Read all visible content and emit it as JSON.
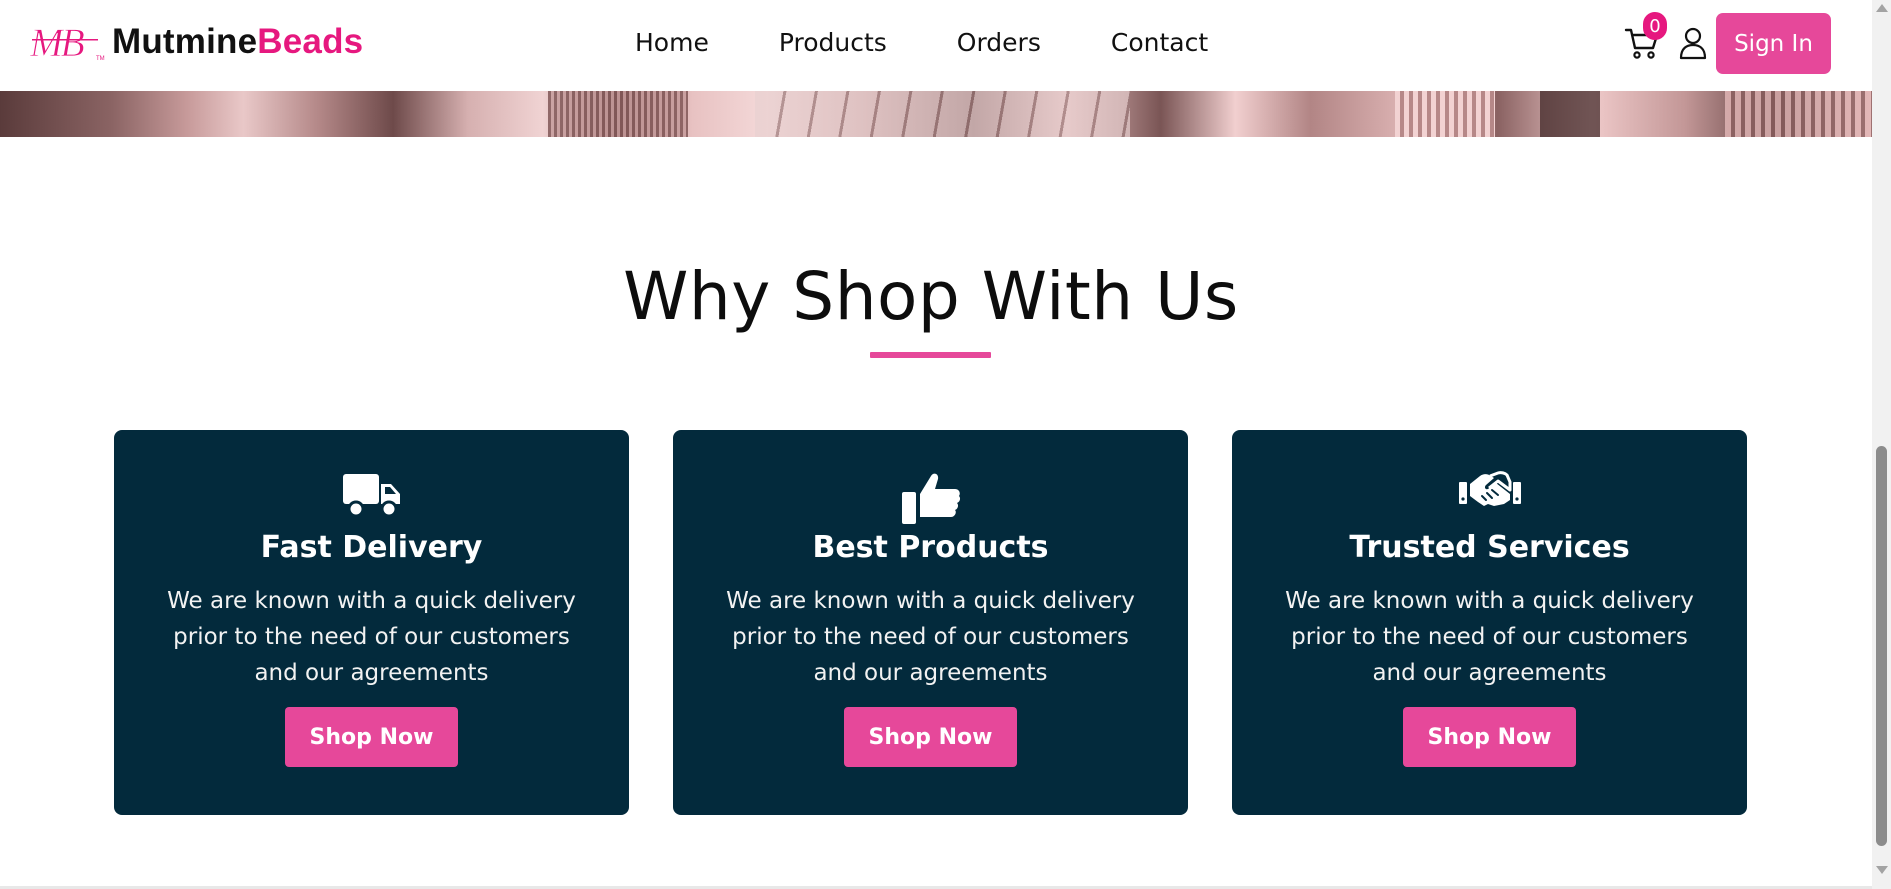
{
  "brand": {
    "logo_mark": "MB",
    "name_part1": "Mutmine",
    "name_part2": "Beads",
    "accent_color": "#e6187f"
  },
  "nav": {
    "items": [
      {
        "label": "Home"
      },
      {
        "label": "Products"
      },
      {
        "label": "Orders"
      },
      {
        "label": "Contact"
      }
    ]
  },
  "header_actions": {
    "cart_count": "0",
    "cart_icon": "cart-icon",
    "user_icon": "user-icon",
    "signin_label": "Sign In"
  },
  "section": {
    "title": "Why Shop With Us",
    "underline_color": "#e6489a"
  },
  "cards": [
    {
      "icon": "truck-icon",
      "title": "Fast Delivery",
      "description": "We are known with a quick delivery prior to the need of our customers and our agreements",
      "button_label": "Shop Now"
    },
    {
      "icon": "thumbs-up-icon",
      "title": "Best Products",
      "description": "We are known with a quick delivery prior to the need of our customers and our agreements",
      "button_label": "Shop Now"
    },
    {
      "icon": "handshake-icon",
      "title": "Trusted Services",
      "description": "We are known with a quick delivery prior to the need of our customers and our agreements",
      "button_label": "Shop Now"
    }
  ],
  "colors": {
    "card_background": "#032a3c",
    "button_pink": "#e6489a"
  }
}
